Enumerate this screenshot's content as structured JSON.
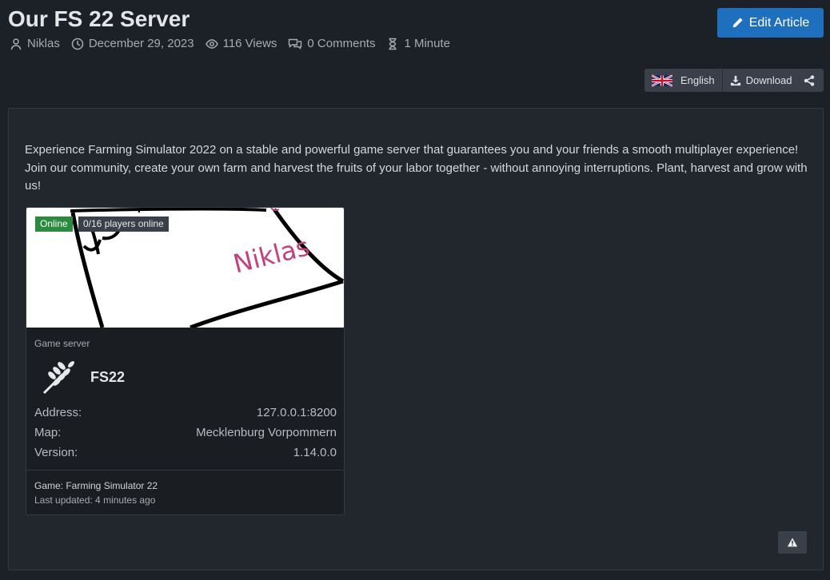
{
  "article": {
    "title": "Our FS 22 Server",
    "author": "Niklas",
    "date": "December 29, 2023",
    "views": "116 Views",
    "comments": "0 Comments",
    "read_time": "1 Minute",
    "intro_text": "Experience Farming Simulator 2022 on a stable and powerful game server that guarantees you and your friends a smooth multiplayer experience! Join our community, create your own farm and harvest the fruits of your labor together - without annoying interruptions. Plant, harvest and grow with us!"
  },
  "toolbar": {
    "edit_label": "Edit Article",
    "language_label": "English",
    "download_label": "Download"
  },
  "server_card": {
    "status": "Online",
    "players": "0/16 players online",
    "image_text": "Niklas",
    "type": "Game server",
    "name": "FS22",
    "rows": [
      {
        "label": "Address:",
        "value": "127.0.0.1:8200"
      },
      {
        "label": "Map:",
        "value": "Mecklenburg Vorpommern"
      },
      {
        "label": "Version:",
        "value": "1.14.0.0"
      }
    ],
    "game": "Game: Farming Simulator 22",
    "last_updated": "Last updated: 4 minutes ago"
  },
  "colors": {
    "accent": "#1f6fbf",
    "online": "#2a8a3e",
    "background": "#1c2027",
    "panel": "#22262d"
  },
  "icons": [
    "user-icon",
    "clock-icon",
    "eye-icon",
    "comments-icon",
    "hourglass-icon",
    "pencil-icon",
    "uk-flag-icon",
    "download-icon",
    "share-icon",
    "wheat-icon",
    "warning-icon"
  ]
}
